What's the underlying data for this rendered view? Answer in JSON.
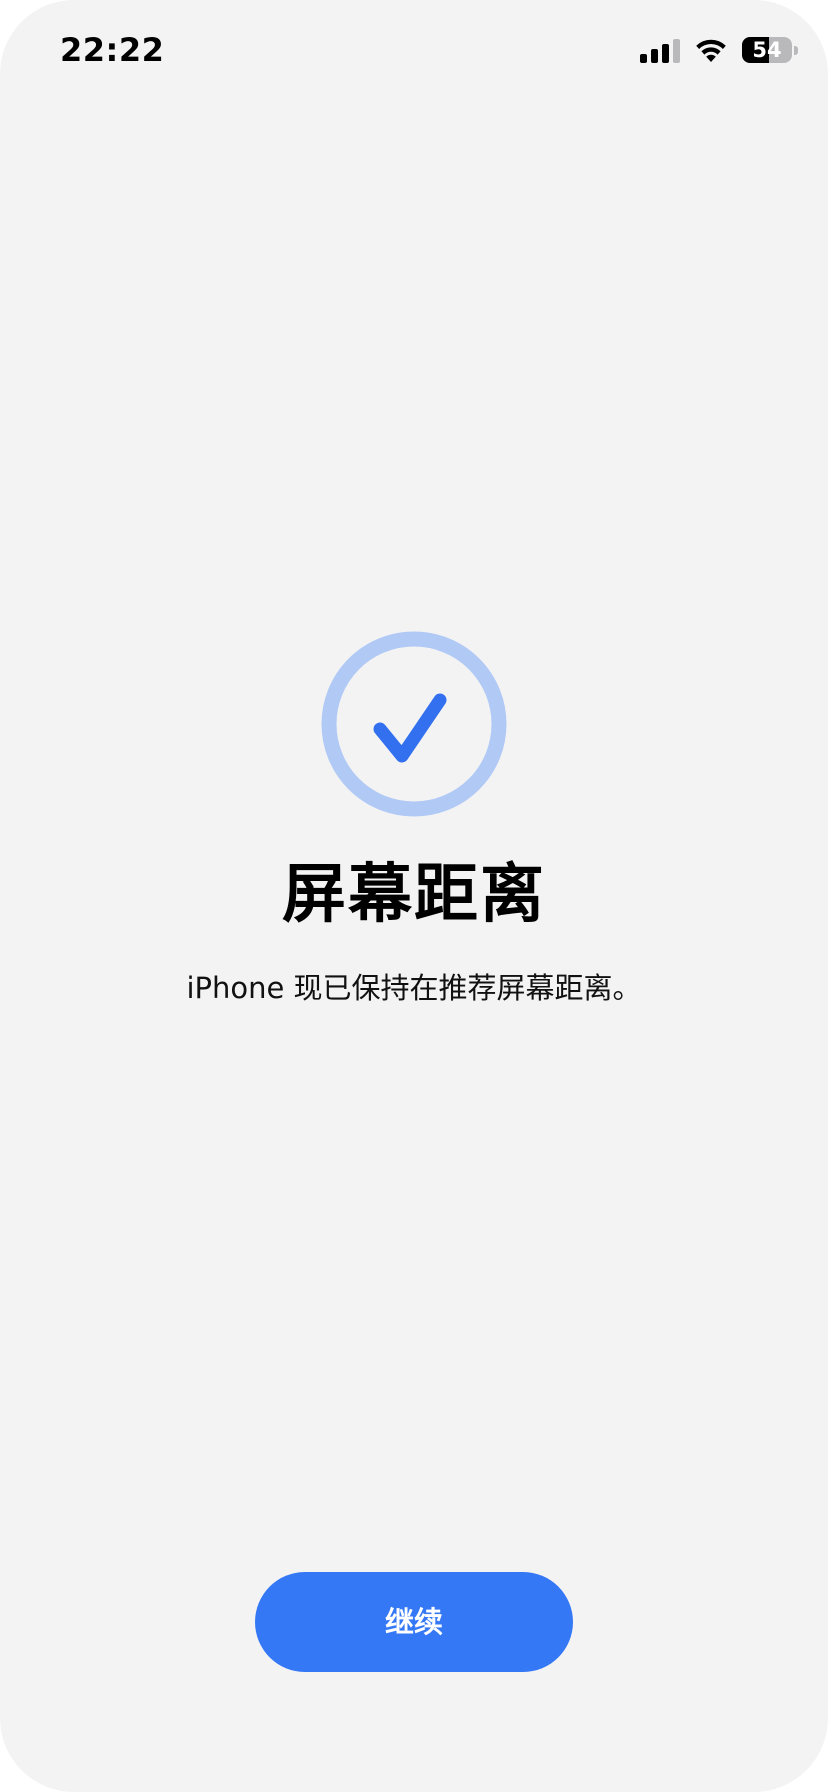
{
  "status_bar": {
    "time": "22:22",
    "battery_level": "54",
    "battery_fraction": 0.54,
    "signal_bars_active": 3,
    "signal_bars_total": 4,
    "icons": [
      "cellular-signal-icon",
      "wifi-icon",
      "battery-icon"
    ]
  },
  "main": {
    "icon": "checkmark-circle-icon",
    "title": "屏幕距离",
    "subtitle": "iPhone 现已保持在推荐屏幕距离。"
  },
  "footer": {
    "continue_label": "继续"
  },
  "colors": {
    "background": "#f3f3f4",
    "accent": "#3478f6",
    "accent_light": "#b0c9f5",
    "check": "#3270ef"
  }
}
